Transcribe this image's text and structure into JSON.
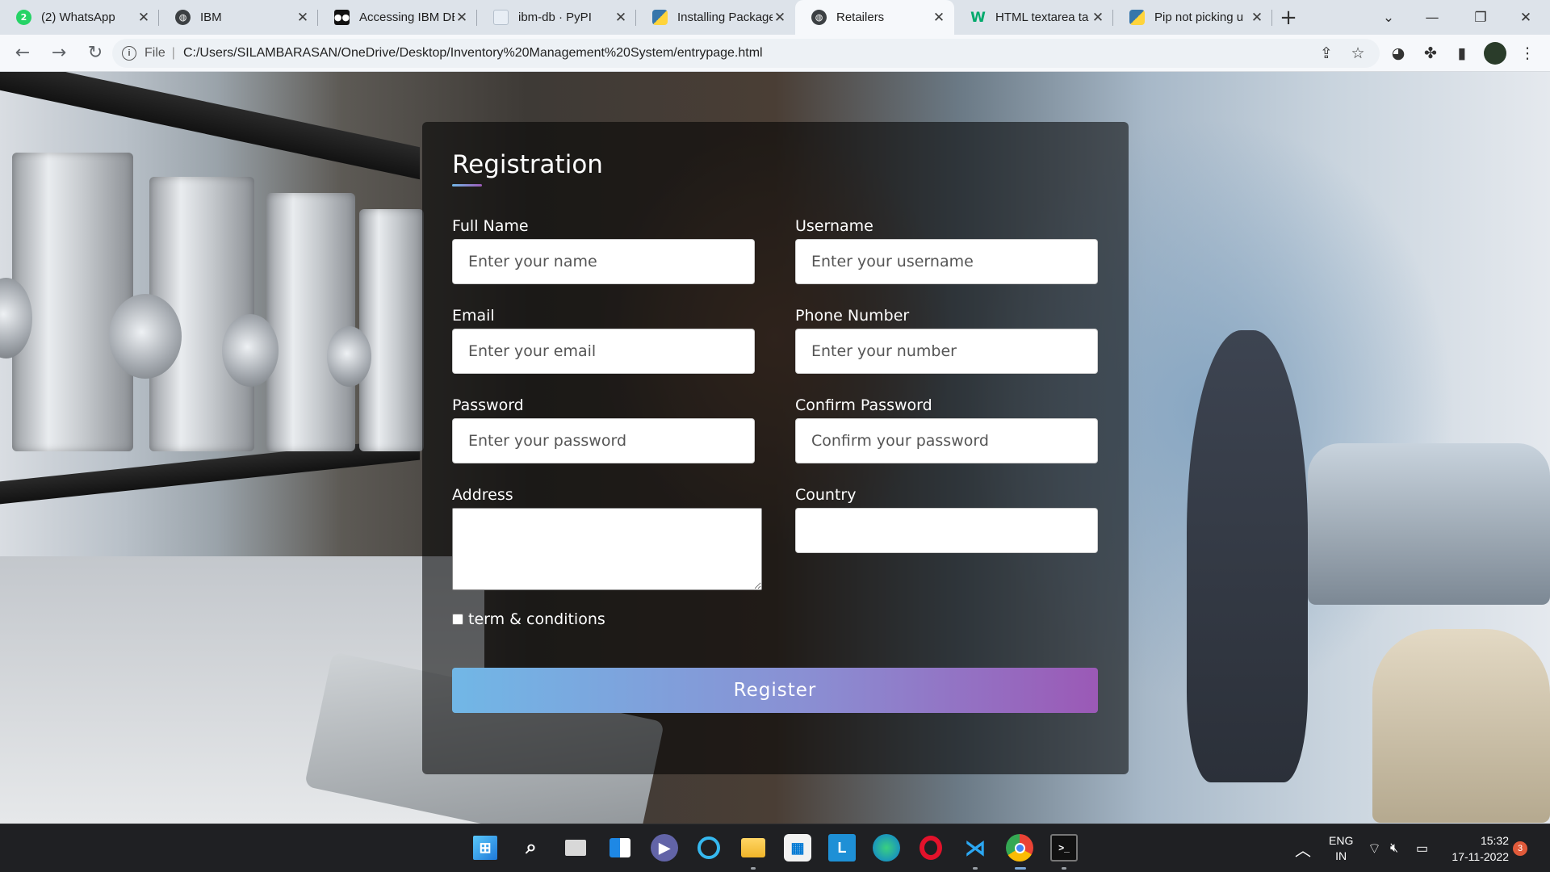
{
  "browser": {
    "tabs": [
      {
        "title": "(2) WhatsApp",
        "icon": "whatsapp-icon",
        "color": "#25d366",
        "glyph": "2",
        "active": false
      },
      {
        "title": "IBM",
        "icon": "globe-icon",
        "color": "#444",
        "glyph": "◍",
        "active": false
      },
      {
        "title": "Accessing IBM DE",
        "icon": "medium-icon",
        "color": "#111",
        "glyph": "●",
        "active": false
      },
      {
        "title": "ibm-db · PyPI",
        "icon": "pypi-icon",
        "color": "#e8eef5",
        "glyph": "▣",
        "active": false
      },
      {
        "title": "Installing Package",
        "icon": "python-icon",
        "color": "#3776ab",
        "glyph": "◆",
        "active": false
      },
      {
        "title": "Retailers",
        "icon": "globe-icon",
        "color": "#444",
        "glyph": "◍",
        "active": true
      },
      {
        "title": "HTML textarea ta",
        "icon": "w3schools-icon",
        "color": "#04aa6d",
        "glyph": "W",
        "active": false
      },
      {
        "title": "Pip not picking u",
        "icon": "python-icon",
        "color": "#f7c948",
        "glyph": "◆",
        "active": false
      }
    ],
    "address": {
      "scheme_label": "File",
      "url": "C:/Users/SILAMBARASAN/OneDrive/Desktop/Inventory%20Management%20System/entrypage.html"
    }
  },
  "form": {
    "title": "Registration",
    "fields": {
      "full_name": {
        "label": "Full Name",
        "placeholder": "Enter your name"
      },
      "username": {
        "label": "Username",
        "placeholder": "Enter your username"
      },
      "email": {
        "label": "Email",
        "placeholder": "Enter your email"
      },
      "phone": {
        "label": "Phone Number",
        "placeholder": "Enter your number"
      },
      "password": {
        "label": "Password",
        "placeholder": "Enter your password"
      },
      "confirm_password": {
        "label": "Confirm Password",
        "placeholder": "Confirm your password"
      },
      "address": {
        "label": "Address"
      },
      "country": {
        "label": "Country"
      }
    },
    "terms_label": "term & conditions",
    "submit_label": "Register",
    "colors": {
      "gradient_start": "#71b7e6",
      "gradient_end": "#9b59b6"
    }
  },
  "taskbar": {
    "apps": [
      "windows-start-icon",
      "search-icon",
      "task-view-icon",
      "widgets-icon",
      "teams-chat-icon",
      "cortana-icon",
      "file-explorer-icon",
      "microsoft-store-icon",
      "lightshot-icon",
      "edge-icon",
      "opera-icon",
      "vscode-icon",
      "chrome-icon",
      "terminal-icon"
    ],
    "language_top": "ENG",
    "language_bottom": "IN",
    "time": "15:32",
    "date": "17-11-2022",
    "notification_count": "3"
  }
}
